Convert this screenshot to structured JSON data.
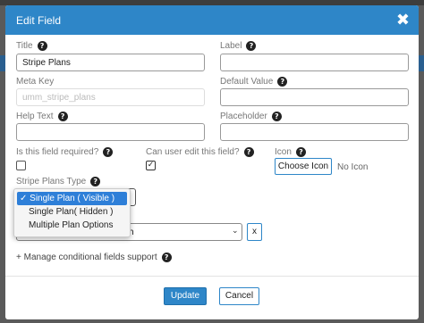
{
  "modal": {
    "title": "Edit Field",
    "close_glyph": "✖"
  },
  "fields": {
    "title": {
      "label": "Title",
      "value": "Stripe Plans"
    },
    "label": {
      "label": "Label",
      "value": ""
    },
    "meta_key": {
      "label": "Meta Key",
      "value": "umm_stripe_plans"
    },
    "default_value": {
      "label": "Default Value",
      "value": ""
    },
    "help_text": {
      "label": "Help Text",
      "value": ""
    },
    "placeholder": {
      "label": "Placeholder",
      "value": ""
    },
    "required": {
      "label": "Is this field required?",
      "checked": false
    },
    "user_editable": {
      "label": "Can user edit this field?",
      "checked": true,
      "check_glyph": "✓"
    },
    "icon": {
      "label": "Icon",
      "choose_label": "Choose Icon",
      "no_icon_text": "No Icon"
    },
    "plans_type": {
      "label": "Stripe Plans Type",
      "options": [
        {
          "text": "✓ Single Plan ( Visible )",
          "selected": true
        },
        {
          "text": "Single Plan( Hidden )",
          "selected": false
        },
        {
          "text": "Multiple Plan Options",
          "selected": false
        }
      ]
    },
    "plan": {
      "value": "Bronze Plan - $10.00/month",
      "remove_label": "x",
      "chevron": "⌄"
    }
  },
  "manage_link": "+ Manage conditional fields support",
  "footer": {
    "update_label": "Update",
    "cancel_label": "Cancel"
  },
  "help_glyph": "?",
  "colors": {
    "header": "#2e86c8",
    "accent": "#2e86c8",
    "selected_option": "#2e7fd8"
  }
}
